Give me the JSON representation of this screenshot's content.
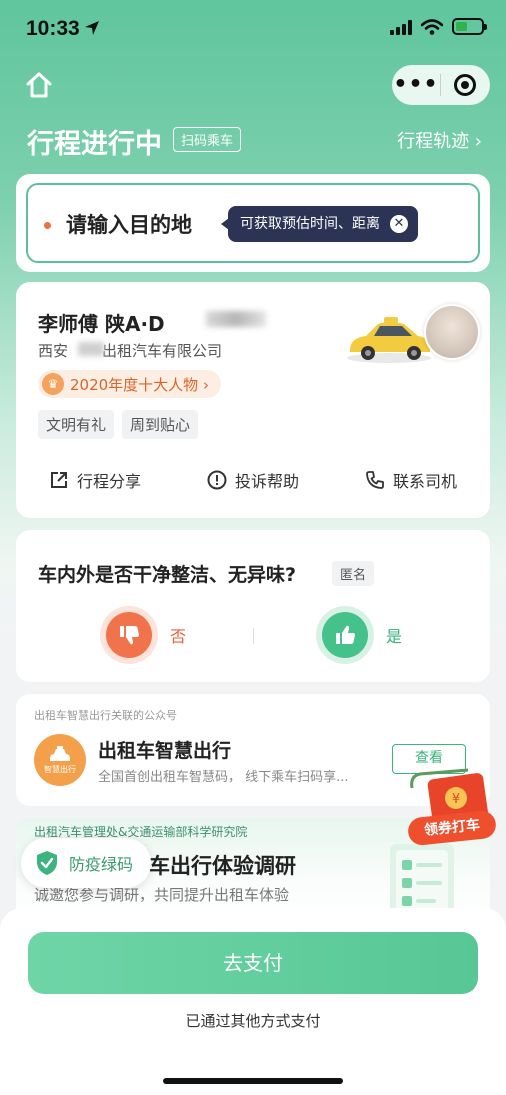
{
  "status_bar": {
    "time": "10:33"
  },
  "header": {
    "title": "行程进行中",
    "scan_tag": "扫码乘车",
    "track_link": "行程轨迹 ›"
  },
  "destination": {
    "placeholder": "请输入目的地",
    "tip": "可获取预估时间、距离"
  },
  "driver": {
    "name": "李师傅  陕A·D",
    "company": "西安",
    "company_suffix": "出租汽车有限公司",
    "award": "2020年度十大人物 ›",
    "tags": [
      "文明有礼",
      "周到贴心"
    ],
    "actions": {
      "share": "行程分享",
      "complaint": "投诉帮助",
      "contact": "联系司机"
    }
  },
  "survey": {
    "question": "车内外是否干净整洁、无异味?",
    "anonymous": "匿名",
    "no_label": "否",
    "yes_label": "是"
  },
  "official_account": {
    "subtitle": "出租车智慧出行关联的公众号",
    "logo_text": "智慧出行",
    "title": "出租车智慧出行",
    "description": "全国首创出租车智慧码， 线下乘车扫码享...",
    "view_button": "查看"
  },
  "coupon": {
    "label": "领券打车"
  },
  "research": {
    "subtitle": "出租汽车管理处&交通运输部科学研究院",
    "title": "车出行体验调研",
    "description": "诚邀您参与调研，共同提升出租车体验"
  },
  "health_badge": {
    "label": "防疫绿码"
  },
  "bottom": {
    "pay_button": "去支付",
    "paid_other": "已通过其他方式支付"
  }
}
